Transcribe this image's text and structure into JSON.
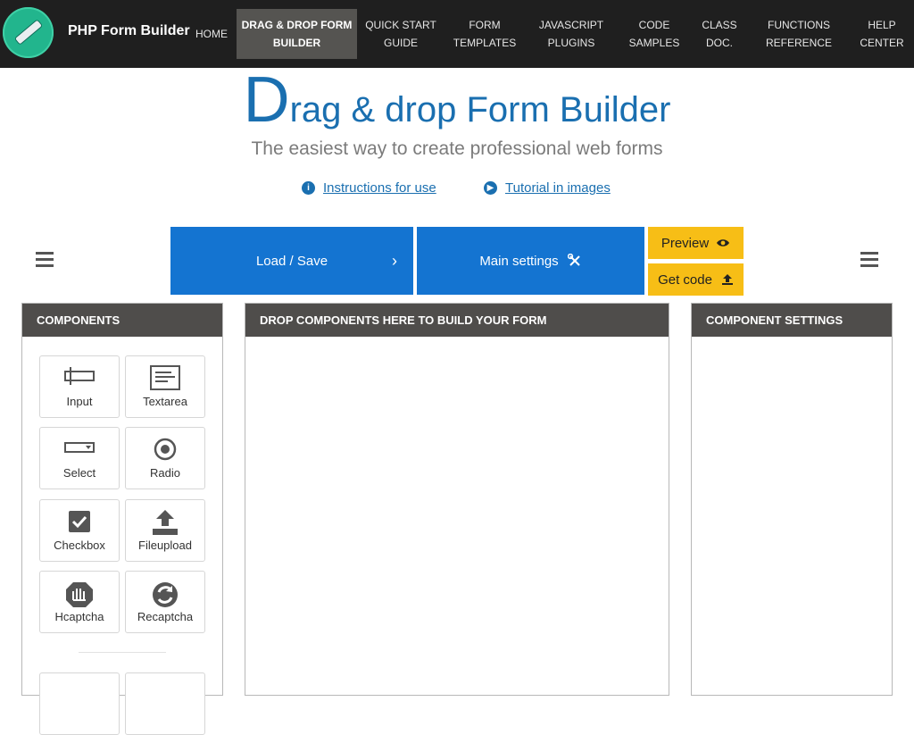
{
  "topbar": {
    "brand": "PHP Form Builder",
    "nav": [
      {
        "label": "HOME"
      },
      {
        "label": "DRAG & DROP FORM BUILDER",
        "active": true
      },
      {
        "label": "QUICK START GUIDE"
      },
      {
        "label": "FORM TEMPLATES"
      },
      {
        "label": "JAVASCRIPT PLUGINS"
      },
      {
        "label": "CODE SAMPLES"
      },
      {
        "label": "CLASS DOC."
      },
      {
        "label": "FUNCTIONS REFERENCE"
      },
      {
        "label": "HELP CENTER"
      }
    ]
  },
  "heading": {
    "cap": "D",
    "rest": "rag & drop Form Builder",
    "subtitle": "The easiest way to create professional web forms"
  },
  "help_links": {
    "instructions": "Instructions for use",
    "tutorial": "Tutorial in images"
  },
  "toolbar": {
    "load_save": "Load / Save",
    "main_settings": "Main settings",
    "preview": "Preview",
    "get_code": "Get code"
  },
  "panels": {
    "components_title": "COMPONENTS",
    "dropzone_title": "DROP COMPONENTS HERE TO BUILD YOUR FORM",
    "settings_title": "COMPONENT SETTINGS"
  },
  "components": [
    {
      "label": "Input",
      "icon": "input-icon"
    },
    {
      "label": "Textarea",
      "icon": "textarea-icon"
    },
    {
      "label": "Select",
      "icon": "select-icon"
    },
    {
      "label": "Radio",
      "icon": "radio-icon"
    },
    {
      "label": "Checkbox",
      "icon": "checkbox-icon"
    },
    {
      "label": "Fileupload",
      "icon": "upload-icon"
    },
    {
      "label": "Hcaptcha",
      "icon": "hcaptcha-icon"
    },
    {
      "label": "Recaptcha",
      "icon": "recaptcha-icon"
    }
  ],
  "colors": {
    "nav_bg": "#1f1f1f",
    "nav_active": "#555451",
    "brand_green": "#22b58d",
    "primary_blue": "#1474d1",
    "heading_blue": "#1a6fb0",
    "accent_yellow": "#f7be16",
    "panel_header": "#4f4d4b"
  }
}
